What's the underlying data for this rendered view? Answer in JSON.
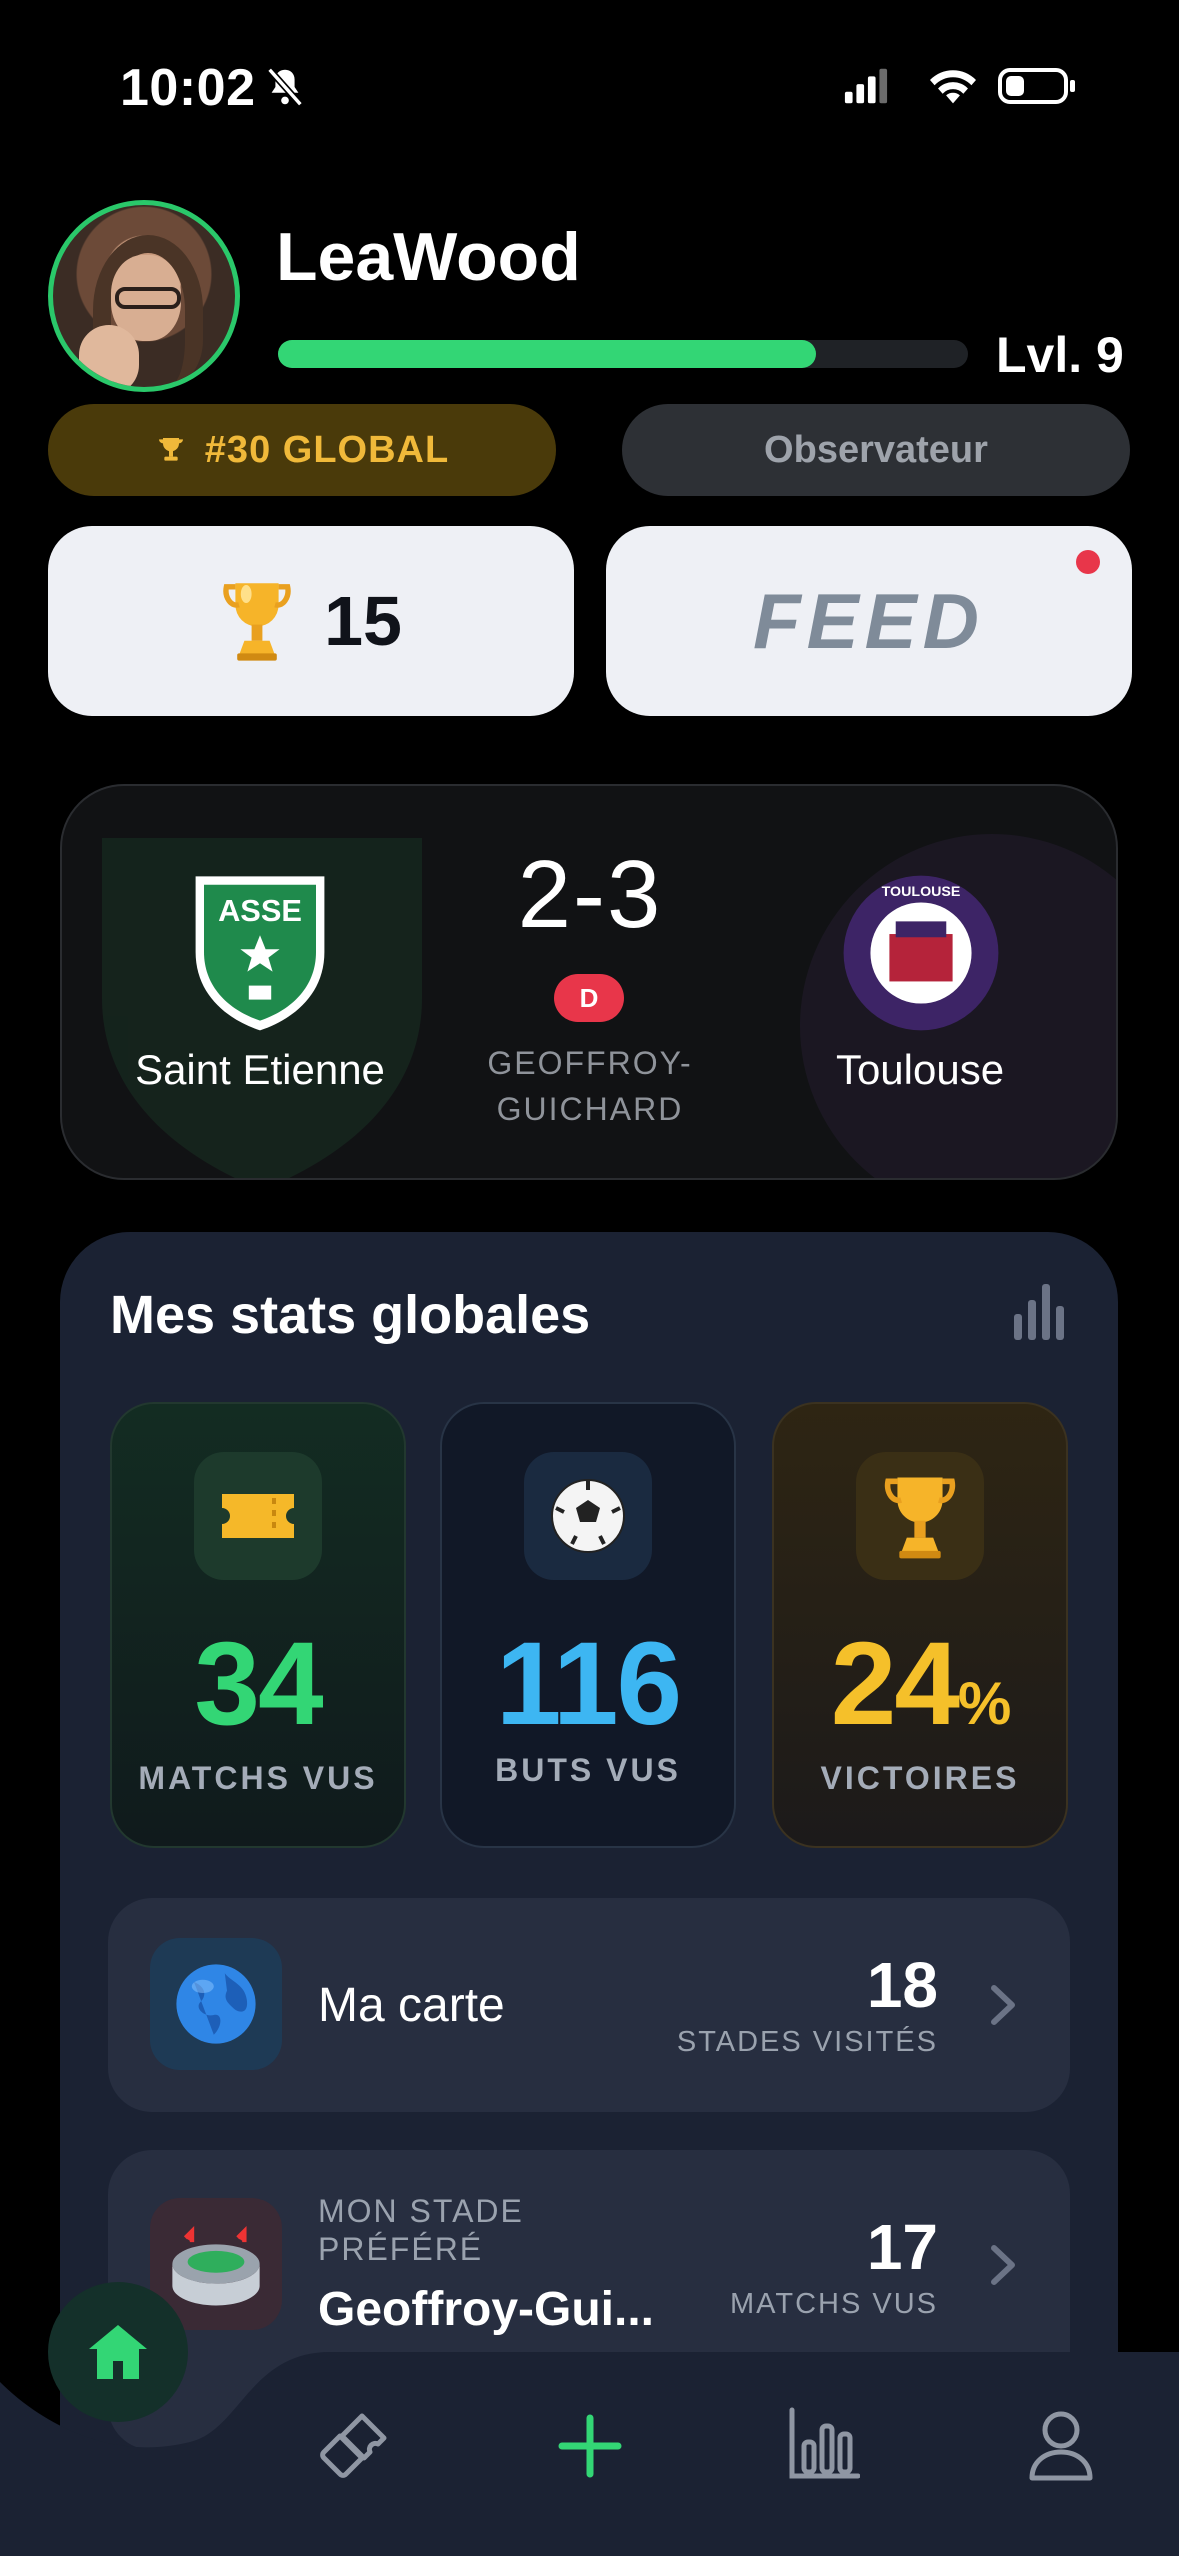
{
  "status_bar": {
    "time": "10:02"
  },
  "profile": {
    "username": "LeaWood",
    "level_label": "Lvl. 9",
    "xp_progress": 0.78,
    "rank_label": "#30 GLOBAL",
    "role_label": "Observateur"
  },
  "actions": {
    "trophy_count": "15",
    "feed_label": "FEED"
  },
  "last_match": {
    "home_team": "Saint Etienne",
    "away_team": "Toulouse",
    "score": "2-3",
    "result_badge": "D",
    "stadium_line1": "GEOFFROY-",
    "stadium_line2": "GUICHARD",
    "home_crest_text": "ASSE",
    "away_crest_text": "TOULOUSE"
  },
  "stats": {
    "title": "Mes stats globales",
    "matches": {
      "value": "34",
      "label": "MATCHS VUS"
    },
    "goals": {
      "value": "116",
      "label": "BUTS VUS"
    },
    "wins": {
      "value": "24",
      "unit": "%",
      "label": "VICTOIRES"
    },
    "map": {
      "title": "Ma carte",
      "value": "18",
      "label": "STADES VISITÉS"
    },
    "favorite": {
      "caption_line1": "MON STADE",
      "caption_line2": "PRÉFÉRÉ",
      "name": "Geoffroy-Gui...",
      "value": "17",
      "label": "MATCHS VUS"
    }
  },
  "colors": {
    "accent_green": "#33d675",
    "stat_blue": "#3db6f2",
    "stat_gold": "#f5c02a",
    "loss_red": "#e8364a"
  },
  "nav": {
    "items": [
      "home-icon",
      "ticket-icon",
      "plus-icon",
      "chart-icon",
      "profile-icon"
    ]
  }
}
